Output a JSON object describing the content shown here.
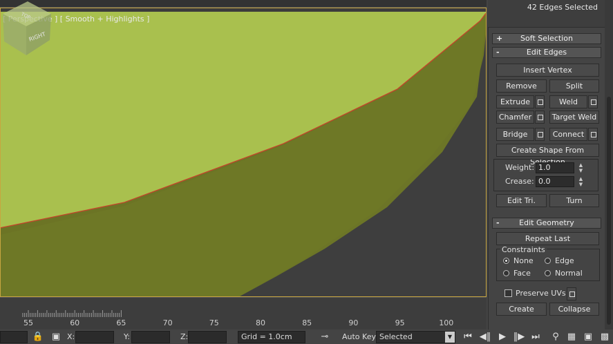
{
  "viewport": {
    "label": "[ Perspective ] [ Smooth + Highlights ]",
    "viewcube": {
      "top": "TOP",
      "right": "RIGHT"
    }
  },
  "timeline": {
    "ruler_labels": [
      "55",
      "60",
      "65",
      "70",
      "75",
      "80",
      "85",
      "90",
      "95",
      "100"
    ]
  },
  "statusbar": {
    "x_label": "X:",
    "y_label": "Y:",
    "z_label": "Z:",
    "x_value": "",
    "y_value": "",
    "z_value": "",
    "grid": "Grid = 1.0cm",
    "auto_key": "Auto Key",
    "key_filter": "Selected"
  },
  "panel": {
    "selection_info": "42 Edges Selected",
    "soft_selection": {
      "sign": "+",
      "title": "Soft Selection"
    },
    "edit_edges": {
      "sign": "-",
      "title": "Edit Edges",
      "insert_vertex": "Insert Vertex",
      "remove": "Remove",
      "split": "Split",
      "extrude": "Extrude",
      "weld": "Weld",
      "chamfer": "Chamfer",
      "target_weld": "Target Weld",
      "bridge": "Bridge",
      "connect": "Connect",
      "create_shape": "Create Shape From Selection",
      "weight_label": "Weight:",
      "weight_value": "1.0",
      "crease_label": "Crease:",
      "crease_value": "0.0",
      "edit_tri": "Edit Tri.",
      "turn": "Turn"
    },
    "edit_geometry": {
      "sign": "-",
      "title": "Edit Geometry",
      "repeat_last": "Repeat Last",
      "constraints_title": "Constraints",
      "none": "None",
      "edge": "Edge",
      "face": "Face",
      "normal": "Normal",
      "preserve_uvs": "Preserve UVs",
      "create": "Create",
      "collapse": "Collapse"
    }
  }
}
